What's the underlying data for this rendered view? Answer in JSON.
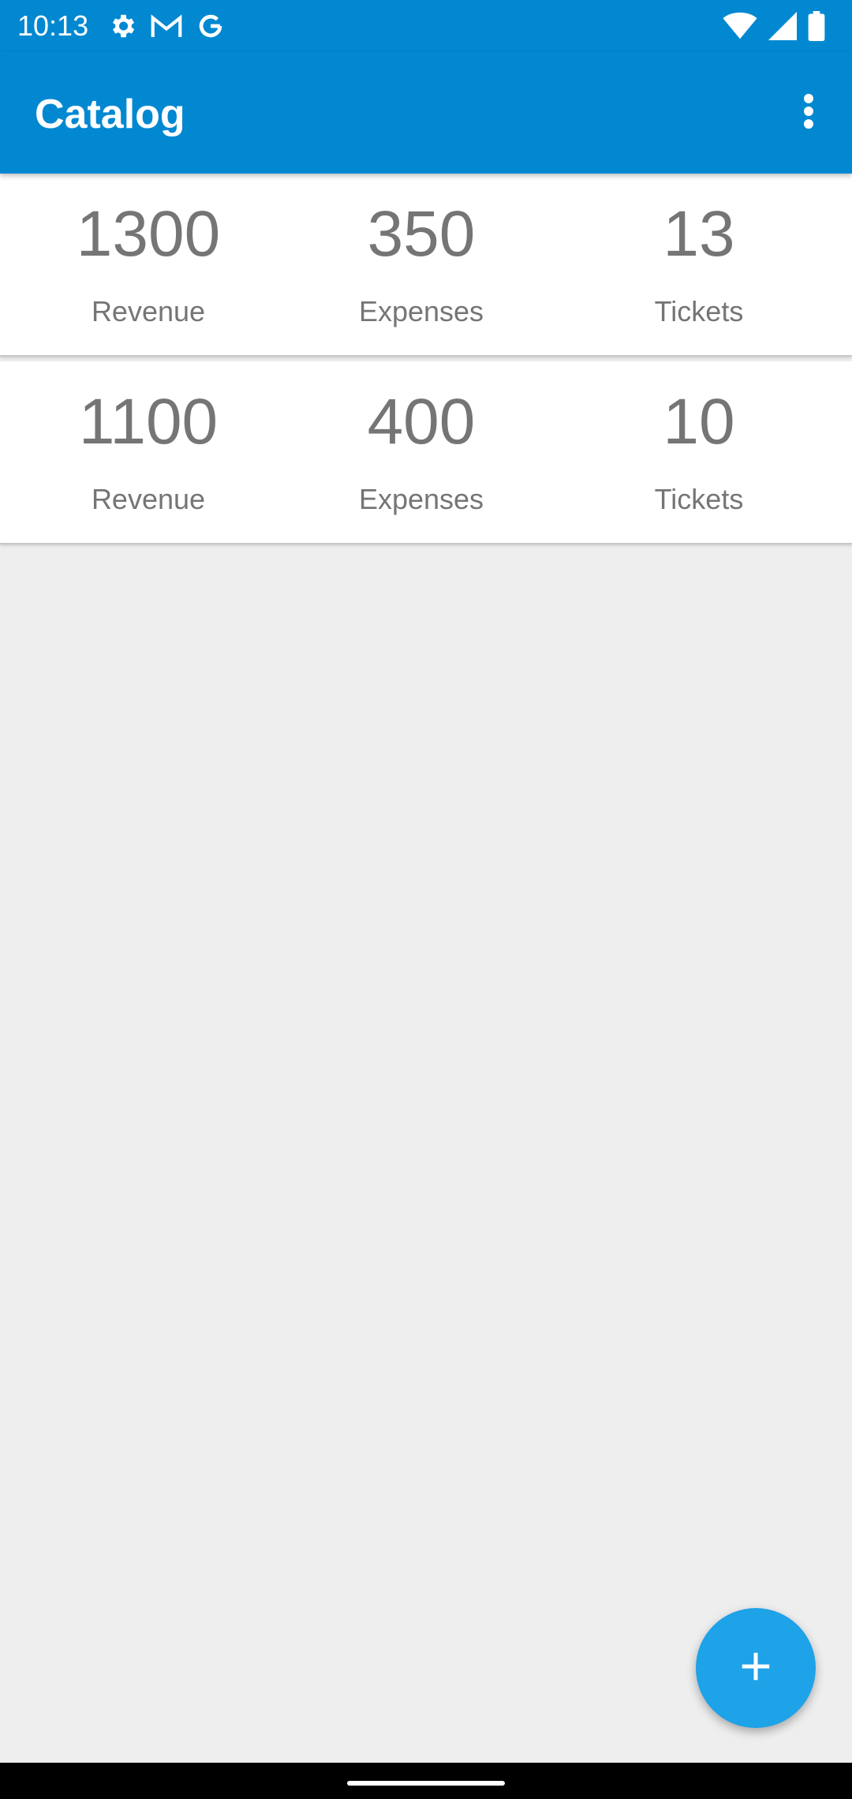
{
  "status_bar": {
    "time": "10:13",
    "left_icons": [
      "gear-icon",
      "gmail-icon",
      "google-icon"
    ],
    "right_icons": [
      "wifi-icon",
      "signal-icon",
      "battery-icon"
    ]
  },
  "app_bar": {
    "title": "Catalog",
    "overflow_icon": "more-vert-icon",
    "color": "#0288d1"
  },
  "cards": [
    {
      "stats": [
        {
          "value": "1300",
          "label": "Revenue"
        },
        {
          "value": "350",
          "label": "Expenses"
        },
        {
          "value": "13",
          "label": "Tickets"
        }
      ]
    },
    {
      "stats": [
        {
          "value": "1100",
          "label": "Revenue"
        },
        {
          "value": "400",
          "label": "Expenses"
        },
        {
          "value": "10",
          "label": "Tickets"
        }
      ]
    }
  ],
  "fab": {
    "icon": "plus-icon",
    "color": "#1ea2e8"
  }
}
